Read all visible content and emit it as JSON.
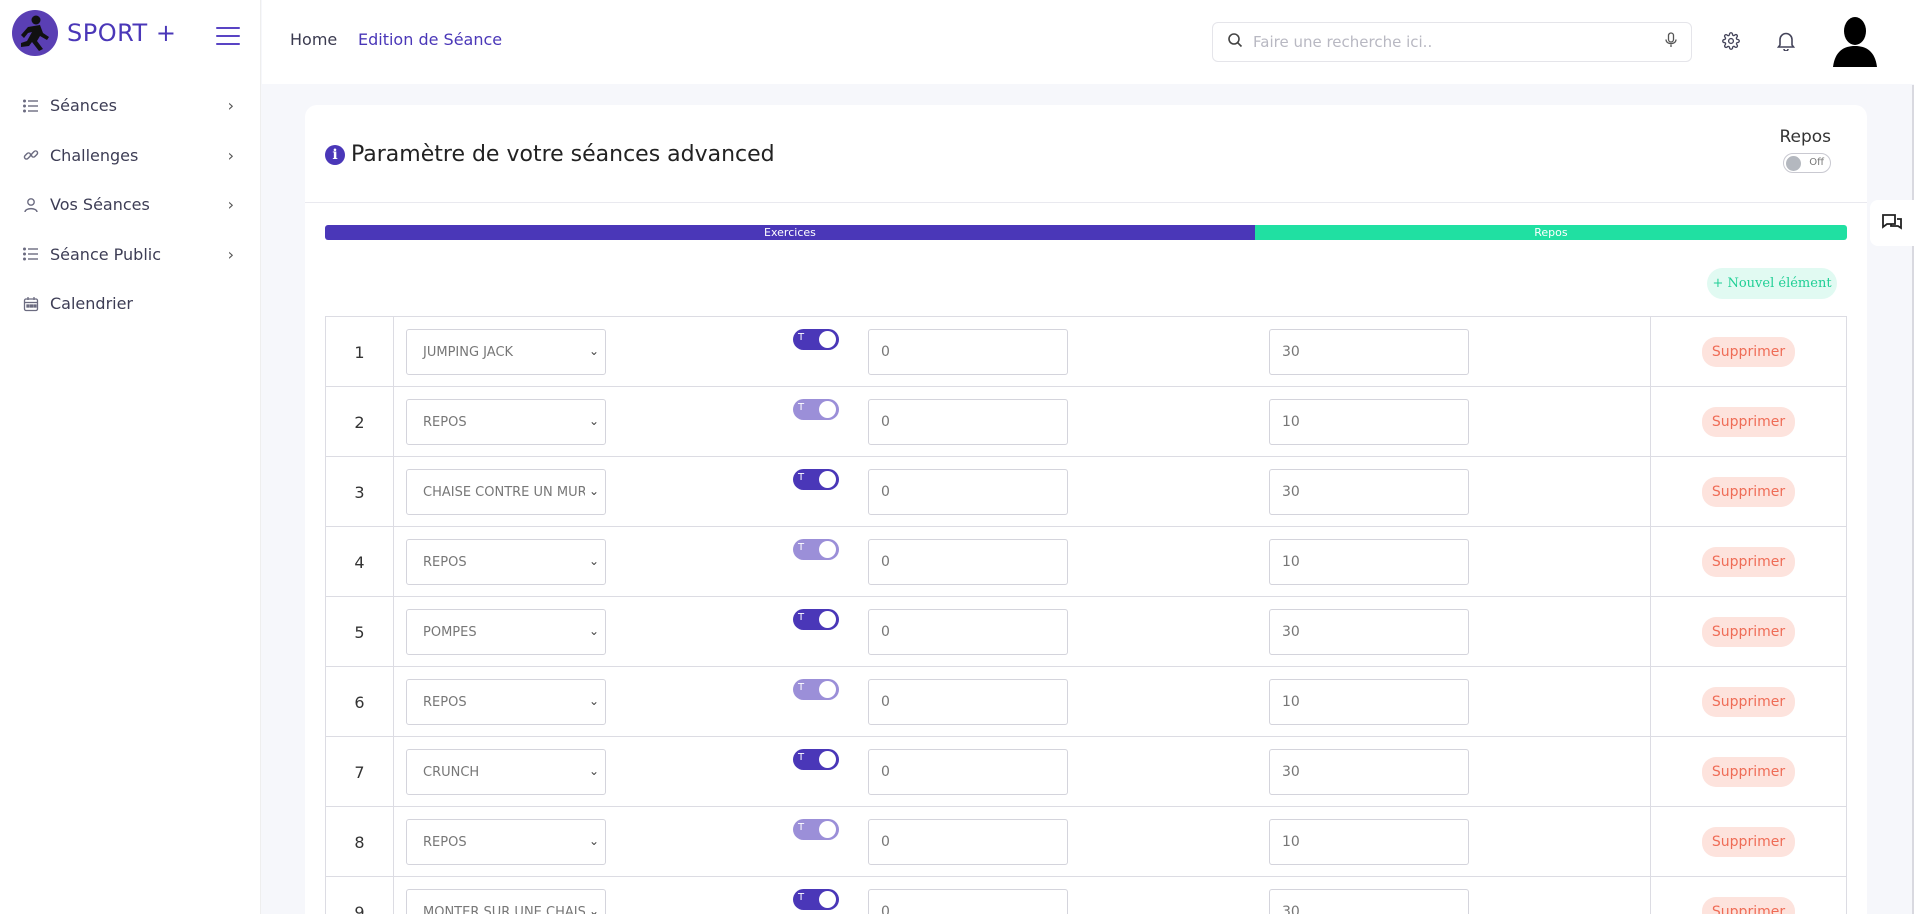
{
  "brand": {
    "name": "SPORT +"
  },
  "sidebar": {
    "items": [
      {
        "label": "Séances",
        "icon": "list-icon",
        "chevron": "›"
      },
      {
        "label": "Challenges",
        "icon": "link-icon",
        "chevron": "›"
      },
      {
        "label": "Vos Séances",
        "icon": "user-icon",
        "chevron": "›"
      },
      {
        "label": "Séance Public",
        "icon": "list-icon",
        "chevron": "›"
      },
      {
        "label": "Calendrier",
        "icon": "calendar-icon",
        "chevron": ""
      }
    ]
  },
  "topbar": {
    "breadcrumb_home": "Home",
    "breadcrumb_current": "Edition de Séance",
    "search_placeholder": "Faire une recherche ici.."
  },
  "card": {
    "title": "Paramètre de votre séances advanced",
    "repos_label": "Repos",
    "repos_toggle_text": "Off",
    "progress": {
      "exercices_label": "Exercices",
      "repos_label": "Repos",
      "exercices_fraction": 0.611
    },
    "new_button_label": "+ Nouvel élément",
    "rows": [
      {
        "num": "1",
        "exercise": "JUMPING JACK",
        "toggle": "T",
        "active": true,
        "v1": "0",
        "v2": "30",
        "delete": "Supprimer"
      },
      {
        "num": "2",
        "exercise": "REPOS",
        "toggle": "T",
        "active": false,
        "v1": "0",
        "v2": "10",
        "delete": "Supprimer"
      },
      {
        "num": "3",
        "exercise": "CHAISE CONTRE UN MUR",
        "toggle": "T",
        "active": true,
        "v1": "0",
        "v2": "30",
        "delete": "Supprimer"
      },
      {
        "num": "4",
        "exercise": "REPOS",
        "toggle": "T",
        "active": false,
        "v1": "0",
        "v2": "10",
        "delete": "Supprimer"
      },
      {
        "num": "5",
        "exercise": "POMPES",
        "toggle": "T",
        "active": true,
        "v1": "0",
        "v2": "30",
        "delete": "Supprimer"
      },
      {
        "num": "6",
        "exercise": "REPOS",
        "toggle": "T",
        "active": false,
        "v1": "0",
        "v2": "10",
        "delete": "Supprimer"
      },
      {
        "num": "7",
        "exercise": "CRUNCH",
        "toggle": "T",
        "active": true,
        "v1": "0",
        "v2": "30",
        "delete": "Supprimer"
      },
      {
        "num": "8",
        "exercise": "REPOS",
        "toggle": "T",
        "active": false,
        "v1": "0",
        "v2": "10",
        "delete": "Supprimer"
      },
      {
        "num": "9",
        "exercise": "MONTER SUR UNE CHAISE",
        "toggle": "T",
        "active": true,
        "v1": "0",
        "v2": "30",
        "delete": "Supprimer"
      }
    ]
  },
  "colors": {
    "accent": "#4a37b8",
    "repos": "#20e0a2",
    "danger": "#ef6c56"
  }
}
